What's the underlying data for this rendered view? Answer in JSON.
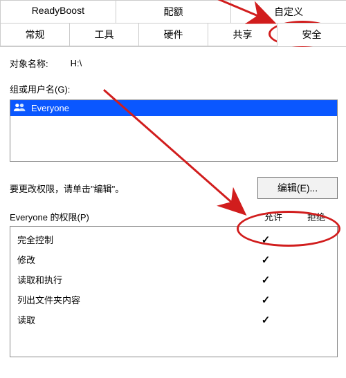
{
  "tabs": {
    "row1": [
      "ReadyBoost",
      "配额",
      "自定义"
    ],
    "row2": [
      "常规",
      "工具",
      "硬件",
      "共享",
      "安全"
    ]
  },
  "object": {
    "label": "对象名称:",
    "value": "H:\\"
  },
  "groups": {
    "label": "组或用户名(G):",
    "items": [
      "Everyone"
    ]
  },
  "editHint": "要更改权限，请单击\"编辑\"。",
  "editBtn": "编辑(E)...",
  "permHeader": {
    "name": "Everyone 的权限(P)",
    "allow": "允许",
    "deny": "拒绝"
  },
  "perms": [
    {
      "name": "完全控制",
      "allow": true,
      "deny": false
    },
    {
      "name": "修改",
      "allow": true,
      "deny": false
    },
    {
      "name": "读取和执行",
      "allow": true,
      "deny": false
    },
    {
      "name": "列出文件夹内容",
      "allow": true,
      "deny": false
    },
    {
      "name": "读取",
      "allow": true,
      "deny": false
    }
  ]
}
